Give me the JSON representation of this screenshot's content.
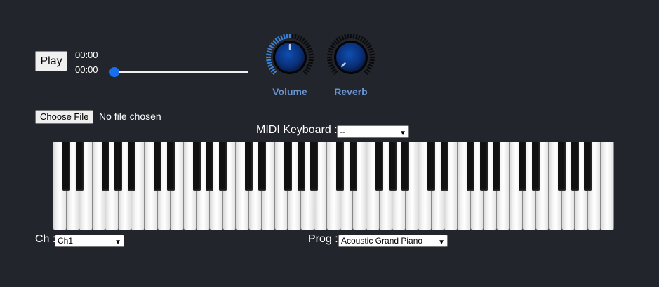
{
  "player": {
    "play_label": "Play",
    "current_time": "00:00",
    "total_time": "00:00",
    "seek_fraction": 0.0
  },
  "knobs": {
    "volume": {
      "label": "Volume",
      "level": 0.5
    },
    "reverb": {
      "label": "Reverb",
      "level": 0.0
    }
  },
  "file": {
    "button_label": "Choose File",
    "status": "No file chosen"
  },
  "midi": {
    "label": "MIDI Keyboard :",
    "selected": "--"
  },
  "keyboard": {
    "white_keys": 43,
    "first_note": "C"
  },
  "channel": {
    "label": "Ch :",
    "selected": "Ch1"
  },
  "program": {
    "label": "Prog :",
    "selected": "Acoustic Grand Piano"
  },
  "colors": {
    "background": "#23252c",
    "accent": "#1a6ff0",
    "knob_label": "#6a93cf"
  }
}
